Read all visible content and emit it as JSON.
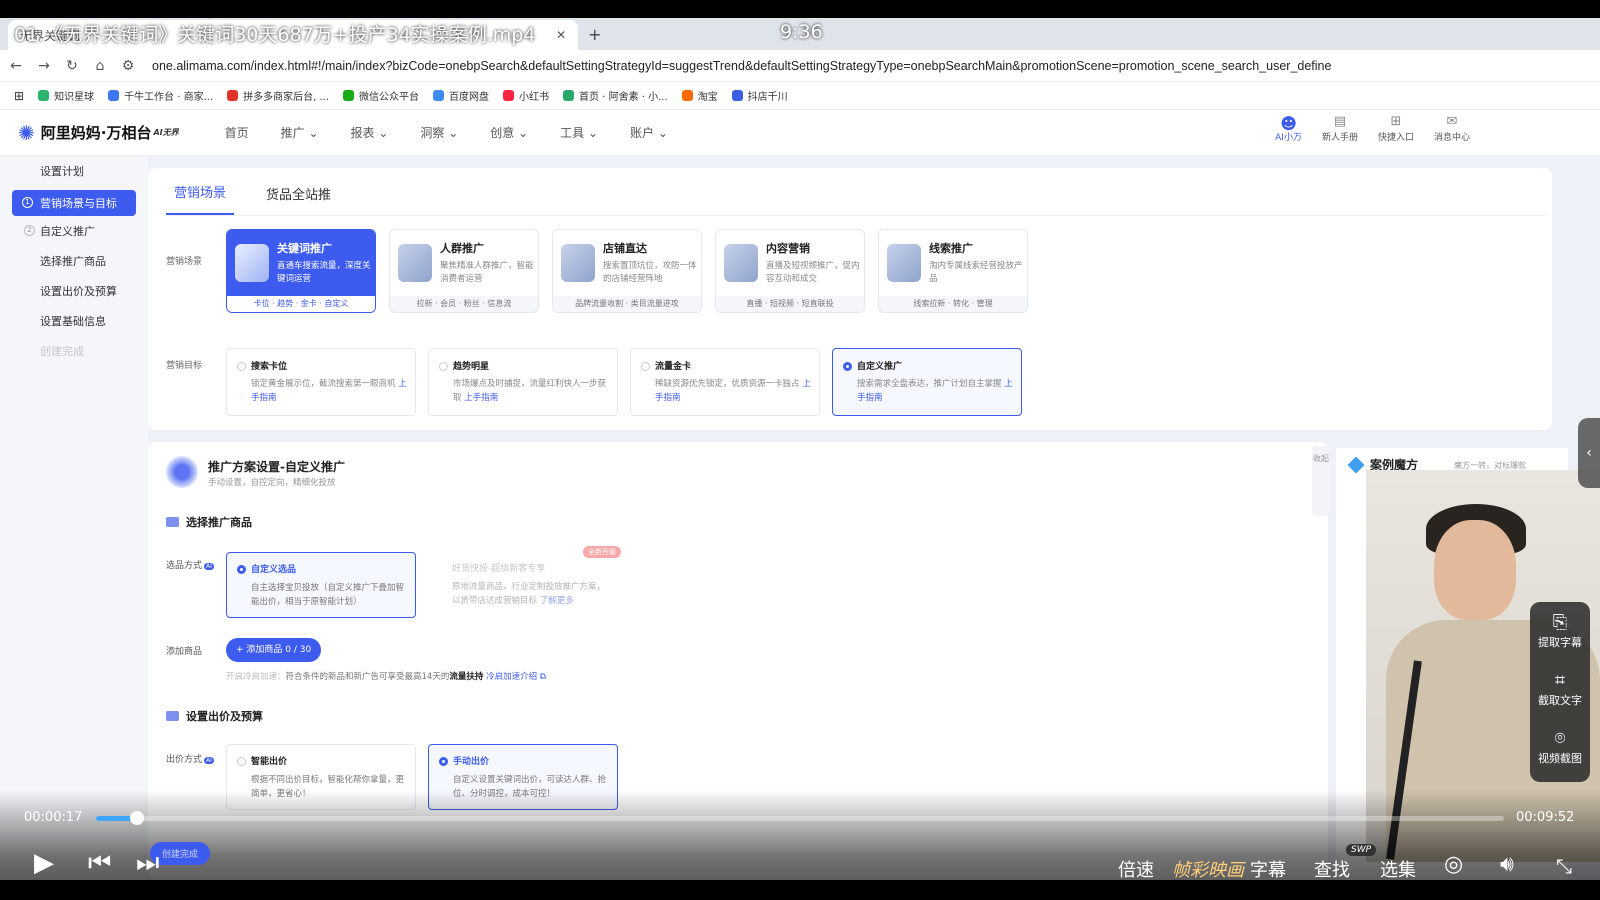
{
  "player": {
    "title": "01.《无界关键词》关键词30天687万+投产34实操案例.mp4",
    "clock": "9:36",
    "current": "00:00:17",
    "total": "00:09:52",
    "progress": 0.029,
    "buttons": {
      "speed": "倍速",
      "effect": "帧彩映画",
      "subtitle": "字幕",
      "find": "查找",
      "svip": "SWP",
      "episodes": "选集"
    },
    "tools": [
      "提取字幕",
      "截取文字",
      "视频截图"
    ]
  },
  "browser": {
    "tab_title": "无界关键词",
    "new_tab": "+",
    "url": "one.alimama.com/index.html#!/main/index?bizCode=onebpSearch&defaultSettingStrategyId=suggestTrend&defaultSettingStrategyType=onebpSearchMain&promotionScene=promotion_scene_search_user_define",
    "bookmarks": [
      {
        "label": "知识星球",
        "color": "#2bb46e"
      },
      {
        "label": "千牛工作台 · 商家...",
        "color": "#3e78f0"
      },
      {
        "label": "拼多多商家后台, ...",
        "color": "#e0342b"
      },
      {
        "label": "微信公众平台",
        "color": "#1aad19"
      },
      {
        "label": "百度网盘",
        "color": "#3e8cf0"
      },
      {
        "label": "小红书",
        "color": "#ff2442"
      },
      {
        "label": "首页 · 阿舍素 · 小...",
        "color": "#2aa86a"
      },
      {
        "label": "淘宝",
        "color": "#ff6a00"
      },
      {
        "label": "抖店千川",
        "color": "#3a5fe0"
      }
    ]
  },
  "app": {
    "logo": "阿里妈妈·万相台",
    "logo_sup": "AI无界",
    "menu": [
      "首页",
      "推广 ⌄",
      "报表 ⌄",
      "洞察 ⌄",
      "创意 ⌄",
      "工具 ⌄",
      "账户 ⌄"
    ],
    "header_right": [
      {
        "label": "AI小万",
        "icon": "robot-icon"
      },
      {
        "label": "新人手册",
        "icon": "doc-icon"
      },
      {
        "label": "快捷入口",
        "icon": "grid-icon"
      },
      {
        "label": "消息中心",
        "icon": "mail-icon"
      }
    ]
  },
  "sidenav": {
    "items": [
      {
        "label": "设置计划",
        "num": ""
      },
      {
        "label": "营销场景与目标",
        "num": "1"
      },
      {
        "label": "自定义推广",
        "num": "2"
      },
      {
        "label": "选择推广商品",
        "num": ""
      },
      {
        "label": "设置出价及预算",
        "num": ""
      },
      {
        "label": "设置基础信息",
        "num": ""
      },
      {
        "label": "创建完成",
        "num": ""
      }
    ]
  },
  "scene_card": {
    "tabs": [
      "营销场景",
      "货品全站推"
    ],
    "scene_label": "营销场景",
    "goal_label": "营销目标",
    "scenes": [
      {
        "title": "关键词推广",
        "desc": "直通车搜索流量，深度关键词运营",
        "footer": "卡位 · 趋势 · 金卡 · 自定义"
      },
      {
        "title": "人群推广",
        "desc": "聚焦精准人群推广，智能消费者运营",
        "footer": "拉新 · 会员 · 粉丝 · 信息流"
      },
      {
        "title": "店铺直达",
        "desc": "搜索置顶坑位，攻防一体的店铺经营阵地",
        "footer": "品牌流量收割 · 类目流量进攻"
      },
      {
        "title": "内容营销",
        "desc": "直播及短视频推广，促内容互动和成交",
        "footer": "直播 · 短视频 · 短直联投"
      },
      {
        "title": "线索推广",
        "desc": "淘内专属线索经营投放产品",
        "footer": "线索拉新 · 转化 · 管理"
      }
    ],
    "goals": [
      {
        "title": "搜索卡位",
        "desc": "锁定黄金展示位，截流搜索第一眼商机",
        "link": "上手指南"
      },
      {
        "title": "趋势明星",
        "desc": "市场爆点及时捕捉，流量红利快人一步获取",
        "link": "上手指南"
      },
      {
        "title": "流量金卡",
        "desc": "稀缺资源优先锁定，优质资源一卡独占",
        "link": "上手指南"
      },
      {
        "title": "自定义推广",
        "desc": "搜索需求全盘表达，推广计划自主掌握",
        "link": "上手指南"
      }
    ]
  },
  "plan": {
    "title": "推广方案设置-自定义推广",
    "subtitle": "手动设置，自控定向，精细化投放",
    "collapse": "收起",
    "sec_product": "选择推广商品",
    "select_label": "选品方式",
    "product_opts": [
      {
        "title": "自定义选品",
        "desc": "自主选择宝贝投放（自定义推广下叠加智能出价，相当于原智能计划）"
      },
      {
        "title": "好货快投-超级新客专享",
        "desc": "原地流量商品，行业定制投放推广方案，以货带店达成营销目标",
        "link": "了解更多"
      }
    ],
    "badge": "全新升级",
    "add_label": "添加商品",
    "add_btn": "+ 添加商品 0 / 30",
    "hint": {
      "prefix": "开启冷启加速：",
      "text": "符合条件的新品和新广告可享受最高14天的",
      "bold": "流量扶持",
      "link": "冷启加速介绍"
    },
    "sec_bid": "设置出价及预算",
    "bid_label": "出价方式",
    "bid_opts": [
      {
        "title": "智能出价",
        "desc": "根据不同出价目标，智能化帮你拿量，更简单，更省心！"
      },
      {
        "title": "手动出价",
        "desc": "自定义设置关键词出价，可读达人群、抢位、分时调控，成本可控！"
      }
    ],
    "finish": "创建完成"
  },
  "rpanel": {
    "title": "案例魔方",
    "sub": "魔方一转，对标爆款"
  }
}
